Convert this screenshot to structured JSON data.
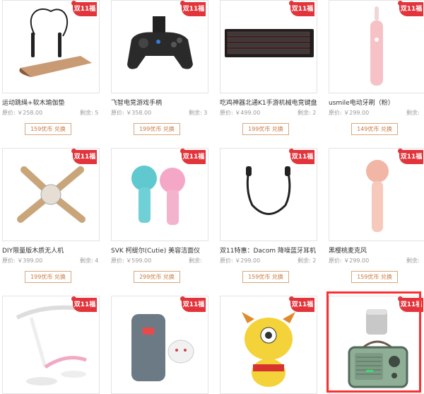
{
  "badge": "双11福",
  "products": [
    {
      "title": "运动跳绳+软木瑜伽垫",
      "price": "原价: ￥258.00",
      "stock": "剩余: 5",
      "btn": "159优币 兑换"
    },
    {
      "title": "飞智电竞游戏手柄",
      "price": "原价: ￥358.00",
      "stock": "剩余: 3",
      "btn": "199优币 兑换"
    },
    {
      "title": "吃鸡神器北通K1手游机械电竞键盘",
      "price": "原价: ￥499.00",
      "stock": "剩余: 2",
      "btn": "199优币 兑换"
    },
    {
      "title": "usmile电动牙刷（粉）",
      "price": "原价: ￥299.00",
      "stock": "剩余: ",
      "btn": "149优币 兑换"
    },
    {
      "title": "DIY限量版木质无人机",
      "price": "原价: ￥399.00",
      "stock": "剩余: 4",
      "btn": "199优币 兑换"
    },
    {
      "title": "SVK 柯缇尔(Cutie) 美容洁面仪",
      "price": "原价: ￥599.00",
      "stock": "剩余: ",
      "btn": "299优币 兑换"
    },
    {
      "title": "双11特惠：Dacom 降噪蓝牙耳机",
      "price": "原价: ￥299.00",
      "stock": "剩余: 2",
      "btn": "159优币 兑换"
    },
    {
      "title": "黑樱桃麦克风",
      "price": "原价: ￥299.00",
      "stock": "剩余: ",
      "btn": "159优币 兑换"
    },
    {
      "title": "",
      "price": "",
      "stock": "",
      "btn": ""
    },
    {
      "title": "",
      "price": "",
      "stock": "",
      "btn": ""
    },
    {
      "title": "",
      "price": "",
      "stock": "",
      "btn": ""
    },
    {
      "title": "",
      "price": "",
      "stock": "",
      "btn": ""
    }
  ],
  "colors": {
    "badge": "#e2343a",
    "button_border": "#d9a77d",
    "highlight": "#ff2f2f"
  }
}
